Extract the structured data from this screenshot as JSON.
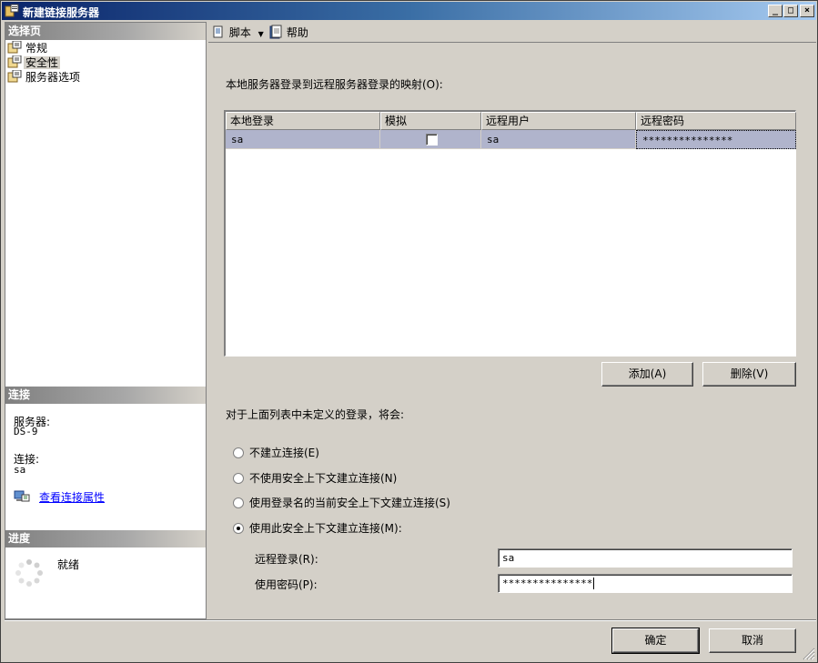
{
  "window": {
    "title": "新建链接服务器",
    "icon": "linked-server-icon",
    "controls": {
      "minimize": "_",
      "maximize": "□",
      "close": "×"
    }
  },
  "left_pane": {
    "select_page": {
      "header": "选择页",
      "items": [
        {
          "label": "常规",
          "icon": "page-icon",
          "selected": false
        },
        {
          "label": "安全性",
          "icon": "page-icon",
          "selected": true
        },
        {
          "label": "服务器选项",
          "icon": "page-icon",
          "selected": false
        }
      ]
    },
    "connection": {
      "header": "连接",
      "server_label": "服务器:",
      "server_value": "DS-9",
      "connection_label": "连接:",
      "connection_value": "sa",
      "view_properties_link": "查看连接属性"
    },
    "progress": {
      "header": "进度",
      "status": "就绪"
    }
  },
  "toolbar": {
    "script_label": "脚本",
    "help_label": "帮助"
  },
  "main": {
    "mapping_label": "本地服务器登录到远程服务器登录的映射(O):",
    "grid": {
      "columns": [
        "本地登录",
        "模拟",
        "远程用户",
        "远程密码"
      ],
      "rows": [
        {
          "local_login": "sa",
          "impersonate": false,
          "remote_user": "sa",
          "remote_password": "***************"
        }
      ]
    },
    "add_button": "添加(A)",
    "remove_button": "删除(V)",
    "undefined_label": "对于上面列表中未定义的登录，将会:",
    "options": [
      {
        "label": "不建立连接(E)",
        "checked": false
      },
      {
        "label": "不使用安全上下文建立连接(N)",
        "checked": false
      },
      {
        "label": "使用登录名的当前安全上下文建立连接(S)",
        "checked": false
      },
      {
        "label": "使用此安全上下文建立连接(M):",
        "checked": true
      }
    ],
    "remote_login_label": "远程登录(R):",
    "remote_login_value": "sa",
    "password_label": "使用密码(P):",
    "password_value": "***************"
  },
  "footer": {
    "ok_button": "确定",
    "cancel_button": "取消"
  }
}
